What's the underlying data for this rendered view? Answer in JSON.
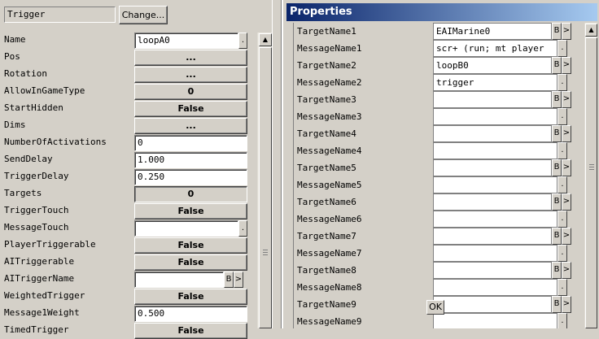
{
  "left_panel": {
    "class_field": "Trigger",
    "change_button": "Change...",
    "rows": [
      {
        "label": "Name",
        "type": "text",
        "value": "loopA0",
        "dot": "."
      },
      {
        "label": "Pos",
        "type": "button",
        "value": "..."
      },
      {
        "label": "Rotation",
        "type": "button",
        "value": "..."
      },
      {
        "label": "AllowInGameType",
        "type": "button",
        "value": "0"
      },
      {
        "label": "StartHidden",
        "type": "button",
        "value": "False"
      },
      {
        "label": "Dims",
        "type": "button",
        "value": "..."
      },
      {
        "label": "NumberOfActivations",
        "type": "text",
        "value": "0"
      },
      {
        "label": "SendDelay",
        "type": "text",
        "value": "1.000"
      },
      {
        "label": "TriggerDelay",
        "type": "text",
        "value": "0.250"
      },
      {
        "label": "Targets",
        "type": "button",
        "value": "0"
      },
      {
        "label": "TriggerTouch",
        "type": "button",
        "value": "False"
      },
      {
        "label": "MessageTouch",
        "type": "text",
        "value": "",
        "dot": "."
      },
      {
        "label": "PlayerTriggerable",
        "type": "button",
        "value": "False"
      },
      {
        "label": "AITriggerable",
        "type": "button",
        "value": "False"
      },
      {
        "label": "AITriggerName",
        "type": "text",
        "value": "",
        "b": "B",
        "arrow": ">"
      },
      {
        "label": "WeightedTrigger",
        "type": "button",
        "value": "False"
      },
      {
        "label": "Message1Weight",
        "type": "text",
        "value": "0.500"
      },
      {
        "label": "TimedTrigger",
        "type": "button",
        "value": "False"
      }
    ]
  },
  "properties": {
    "title": "Properties",
    "ok_label": "OK",
    "rows": [
      {
        "label": "TargetName1",
        "value": "EAIMarine0",
        "b": "B",
        "arrow": ">"
      },
      {
        "label": "MessageName1",
        "value": "scr+ (run; mt player",
        "dot": "."
      },
      {
        "label": "TargetName2",
        "value": "loopB0",
        "b": "B",
        "arrow": ">"
      },
      {
        "label": "MessageName2",
        "value": "trigger",
        "dot": "."
      },
      {
        "label": "TargetName3",
        "value": "",
        "b": "B",
        "arrow": ">"
      },
      {
        "label": "MessageName3",
        "value": "",
        "dot": "."
      },
      {
        "label": "TargetName4",
        "value": "",
        "b": "B",
        "arrow": ">"
      },
      {
        "label": "MessageName4",
        "value": "",
        "dot": "."
      },
      {
        "label": "TargetName5",
        "value": "",
        "b": "B",
        "arrow": ">"
      },
      {
        "label": "MessageName5",
        "value": "",
        "dot": "."
      },
      {
        "label": "TargetName6",
        "value": "",
        "b": "B",
        "arrow": ">"
      },
      {
        "label": "MessageName6",
        "value": "",
        "dot": "."
      },
      {
        "label": "TargetName7",
        "value": "",
        "b": "B",
        "arrow": ">"
      },
      {
        "label": "MessageName7",
        "value": "",
        "dot": "."
      },
      {
        "label": "TargetName8",
        "value": "",
        "b": "B",
        "arrow": ">"
      },
      {
        "label": "MessageName8",
        "value": "",
        "dot": "."
      },
      {
        "label": "TargetName9",
        "value": "",
        "b": "B",
        "arrow": ">"
      },
      {
        "label": "MessageName9",
        "value": "",
        "dot": "."
      }
    ]
  },
  "icons": {
    "scroll_up": "scroll-up-arrow-icon",
    "scroll_down": "scroll-down-arrow-icon",
    "thumb_grip": "grip-icon"
  }
}
